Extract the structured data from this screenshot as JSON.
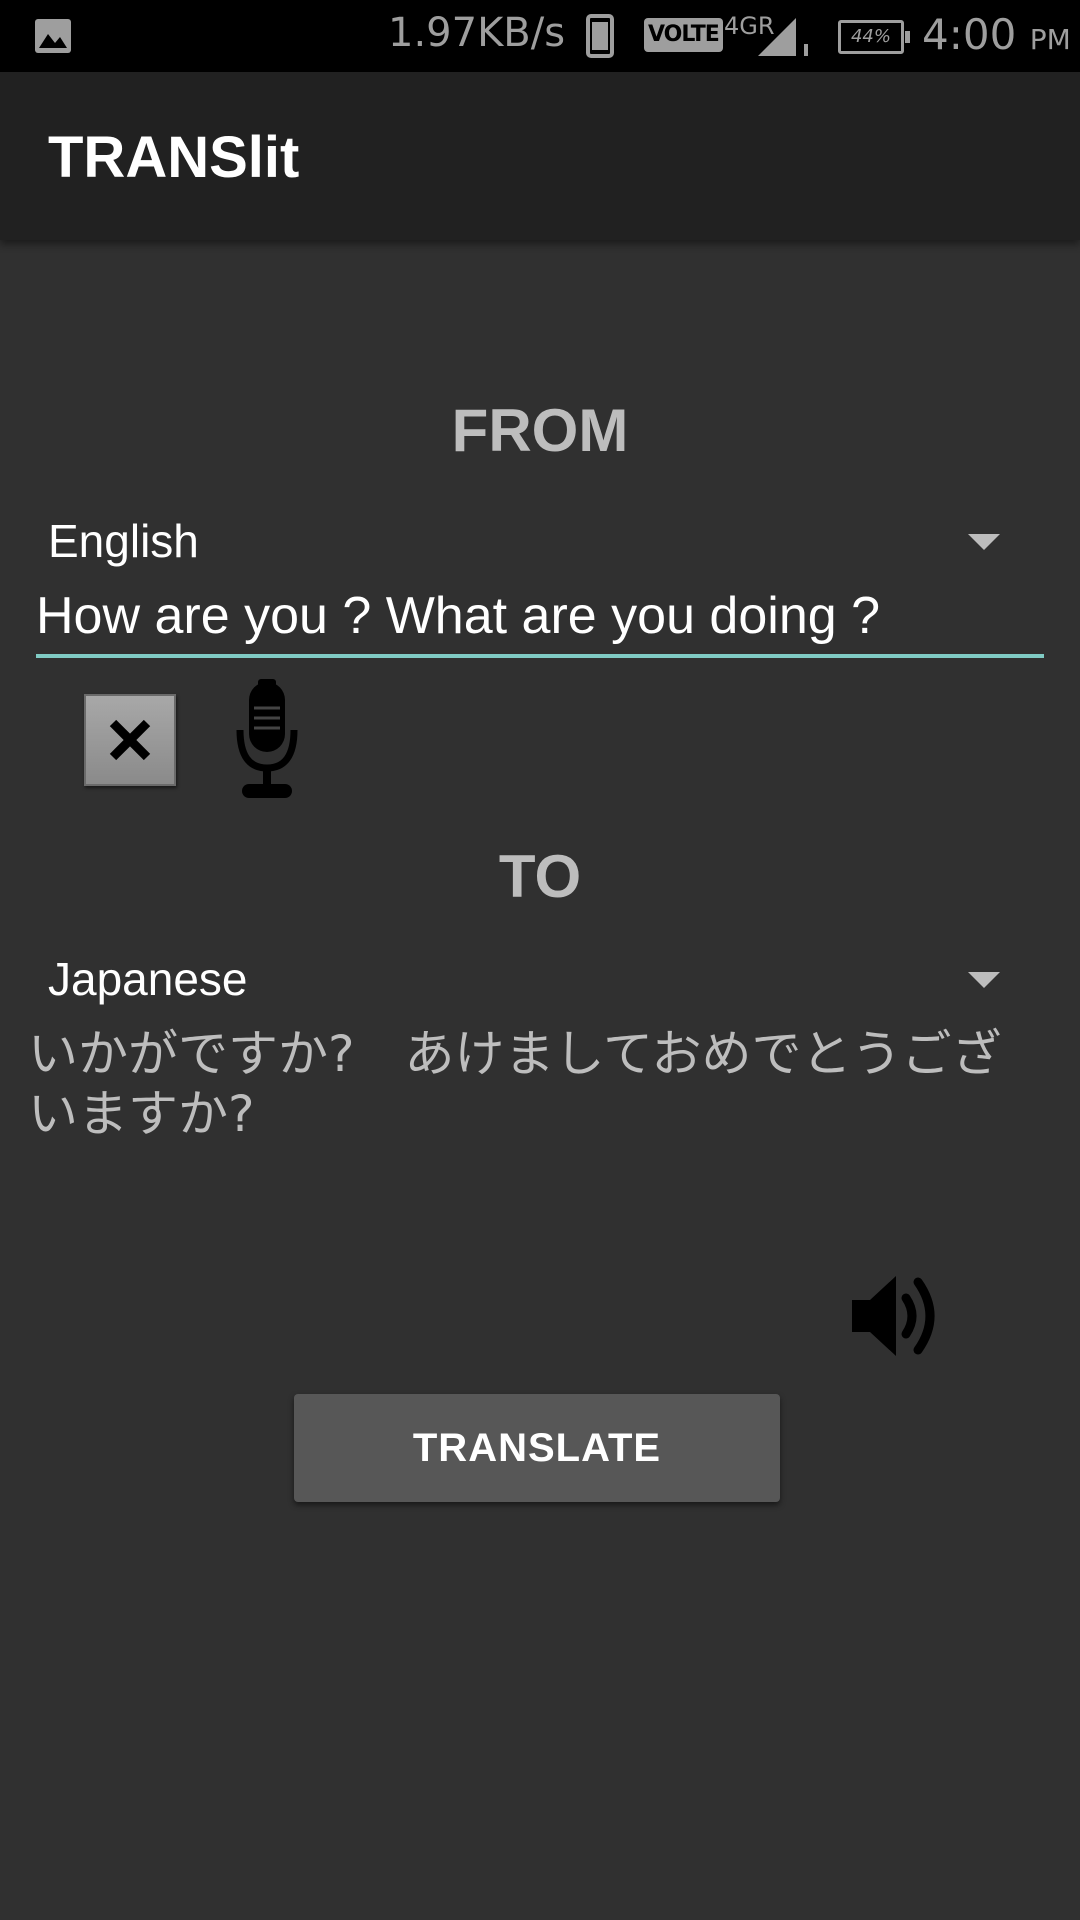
{
  "status_bar": {
    "net_speed": "1.97KB/s",
    "volte_label": "VOLTE",
    "network_label": "4GR",
    "battery_percent": "44%",
    "time": "4:00",
    "ampm": "PM",
    "icons": [
      "gallery-icon",
      "phone-icon",
      "signal-icon",
      "battery-icon"
    ]
  },
  "app_bar": {
    "title": "TRANSlit"
  },
  "from": {
    "header": "FROM",
    "language": "English",
    "input_value": "How are you ? What are you doing ?"
  },
  "actions": {
    "icons": [
      "close-icon",
      "microphone-icon"
    ]
  },
  "to": {
    "header": "TO",
    "language": "Japanese",
    "translated_text": "いかがですか?　あけましておめでとうございますか?"
  },
  "speaker": {
    "icon": "speaker-icon"
  },
  "translate_button": {
    "label": "TRANSLATE"
  },
  "colors": {
    "background": "#303030",
    "app_bar": "#212121",
    "input_underline": "#80cbc4",
    "button": "#575757"
  }
}
